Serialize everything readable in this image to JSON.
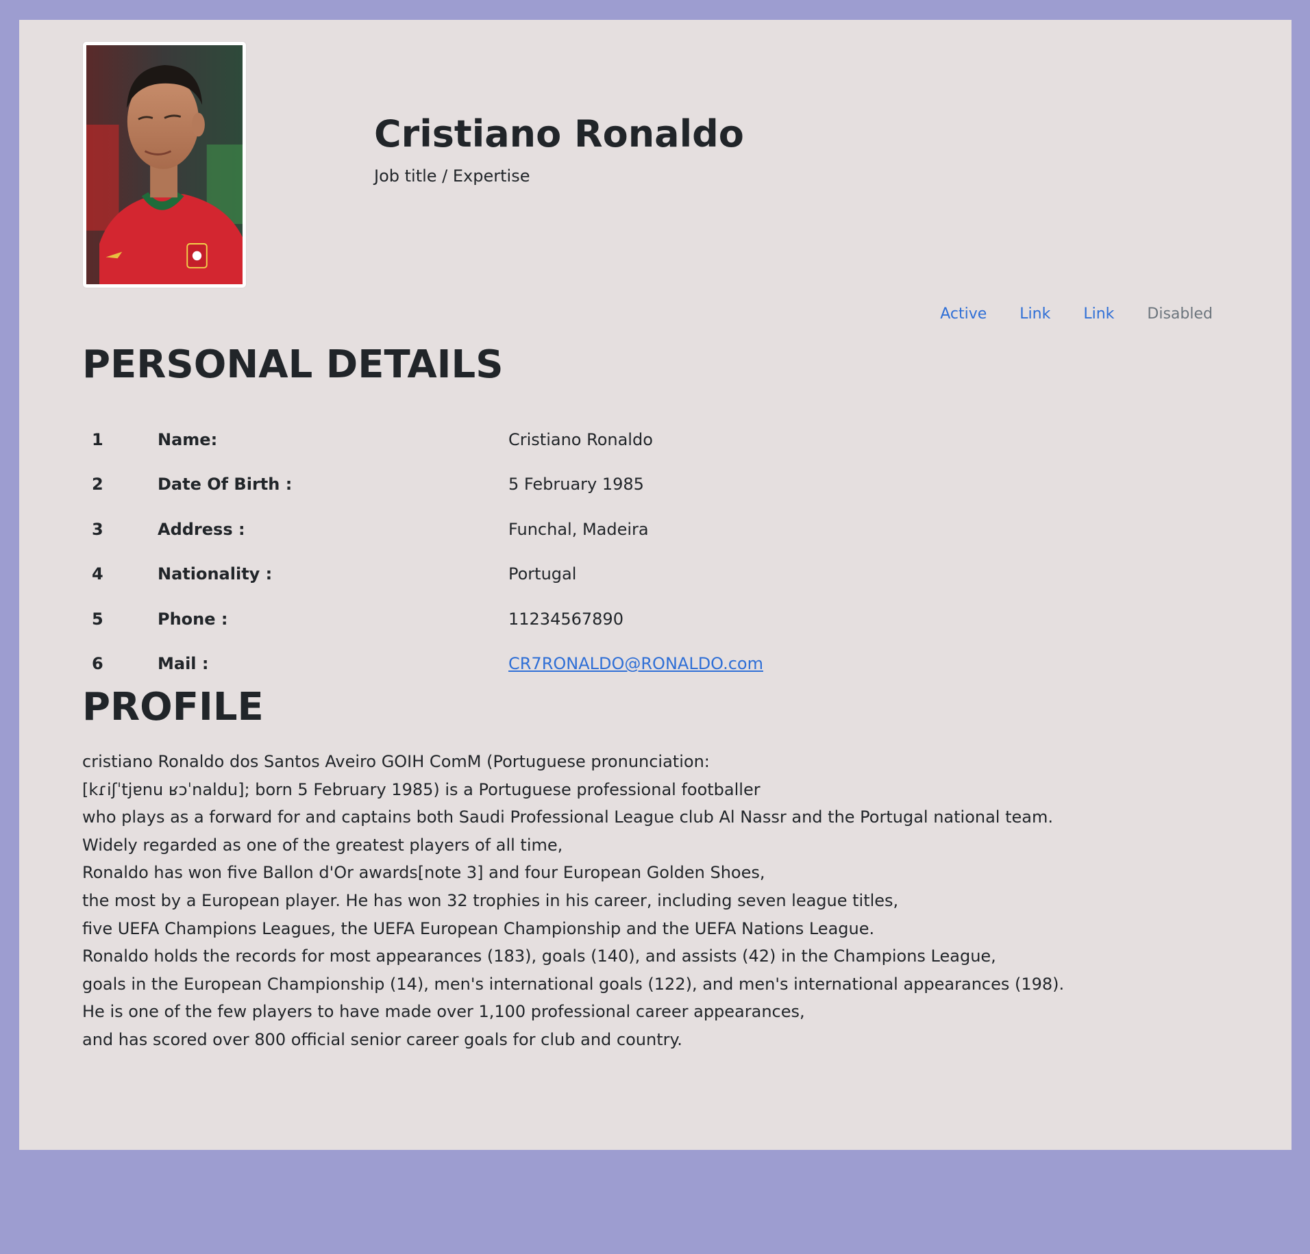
{
  "header": {
    "name": "Cristiano Ronaldo",
    "job_title": "Job title / Expertise",
    "photo_alt": "Cristiano Ronaldo portrait"
  },
  "nav": {
    "items": [
      {
        "label": "Active",
        "state": "active"
      },
      {
        "label": "Link",
        "state": "link"
      },
      {
        "label": "Link",
        "state": "link"
      },
      {
        "label": "Disabled",
        "state": "disabled"
      }
    ]
  },
  "personal_details": {
    "title": "PERSONAL DETAILS",
    "rows": [
      {
        "num": "1",
        "label": "Name:",
        "value": "Cristiano Ronaldo"
      },
      {
        "num": "2",
        "label": "Date Of Birth :",
        "value": "5 February 1985"
      },
      {
        "num": "3",
        "label": "Address :",
        "value": "Funchal, Madeira"
      },
      {
        "num": "4",
        "label": "Nationality :",
        "value": "Portugal"
      },
      {
        "num": "5",
        "label": "Phone :",
        "value": "11234567890"
      },
      {
        "num": "6",
        "label": "Mail :",
        "value": "CR7RONALDO@RONALDO.com"
      }
    ]
  },
  "profile": {
    "title": "PROFILE",
    "lines": [
      "cristiano Ronaldo dos Santos Aveiro GOIH ComM (Portuguese pronunciation:",
      "[kɾiʃˈtjɐnu ʁɔˈnaldu]; born 5 February 1985) is a Portuguese professional footballer",
      "who plays as a forward for and captains both Saudi Professional League club Al Nassr and the Portugal national team.",
      "Widely regarded as one of the greatest players of all time,",
      "Ronaldo has won five Ballon d'Or awards[note 3] and four European Golden Shoes,",
      "the most by a European player. He has won 32 trophies in his career, including seven league titles,",
      "five UEFA Champions Leagues, the UEFA European Championship and the UEFA Nations League.",
      "Ronaldo holds the records for most appearances (183), goals (140), and assists (42) in the Champions League,",
      "goals in the European Championship (14), men's international goals (122), and men's international appearances (198).",
      "He is one of the few players to have made over 1,100 professional career appearances,",
      "and has scored over 800 official senior career goals for club and country."
    ]
  },
  "colors": {
    "page_background": "#9d9dd0",
    "card_background": "#e5dfdf",
    "link": "#2f6fd6",
    "disabled": "#6c757d",
    "text": "#212529"
  }
}
